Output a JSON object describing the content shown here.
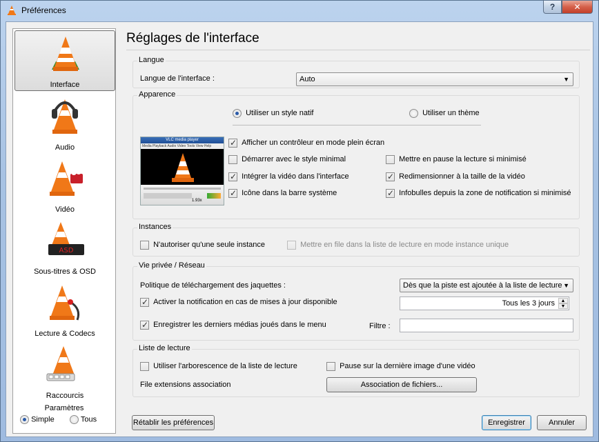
{
  "window": {
    "title": "Préférences",
    "help_label": "?",
    "close_label": "✕"
  },
  "sidebar": {
    "items": [
      {
        "label": "Interface",
        "selected": true
      },
      {
        "label": "Audio"
      },
      {
        "label": "Vidéo"
      },
      {
        "label": "Sous-titres & OSD"
      },
      {
        "label": "Lecture & Codecs"
      },
      {
        "label": "Raccourcis"
      }
    ],
    "params": {
      "title": "Paramètres",
      "simple": "Simple",
      "all": "Tous",
      "selected": "Simple"
    }
  },
  "page": {
    "title": "Réglages de l'interface"
  },
  "langue": {
    "title": "Langue",
    "label": "Langue de l'interface :",
    "value": "Auto"
  },
  "apparence": {
    "title": "Apparence",
    "native_style": "Utiliser un style natif",
    "theme": "Utiliser un thème",
    "preview": {
      "title": "VLC media player",
      "menu": [
        "Media",
        "Playback",
        "Audio",
        "Video",
        "Tools",
        "View",
        "Help"
      ],
      "time": "1.93x"
    },
    "options": {
      "fullscreen_controller": {
        "label": "Afficher un contrôleur en mode plein écran",
        "checked": true
      },
      "minimal": {
        "label": "Démarrer avec le style minimal",
        "checked": false
      },
      "pause_minimized": {
        "label": "Mettre en pause la lecture si minimisé",
        "checked": false
      },
      "embed_video": {
        "label": "Intégrer la vidéo dans l'interface",
        "checked": true
      },
      "resize": {
        "label": "Redimensionner à la taille de la vidéo",
        "checked": true
      },
      "systray": {
        "label": "Icône dans la barre système",
        "checked": true
      },
      "tooltips": {
        "label": "Infobulles depuis la zone de notification si minimisé",
        "checked": true
      }
    }
  },
  "instances": {
    "title": "Instances",
    "single": {
      "label": "N'autoriser qu'une seule instance",
      "checked": false
    },
    "enqueue": {
      "label": "Mettre en file dans la liste de lecture en mode instance unique",
      "checked": false,
      "disabled": true
    }
  },
  "privacy": {
    "title": "Vie privée / Réseau",
    "art_label": "Politique de téléchargement des jaquettes :",
    "art_value": "Dès que la piste est ajoutée à la liste de lecture",
    "update": {
      "label": "Activer la notification en cas de mises à jour disponible",
      "checked": true
    },
    "update_interval": "Tous les 3 jours",
    "recent": {
      "label": "Enregistrer les derniers médias joués dans le menu",
      "checked": true
    },
    "filter_label": "Filtre :",
    "filter_value": ""
  },
  "playlist": {
    "title": "Liste de lecture",
    "tree": {
      "label": "Utiliser l'arborescence de la liste de lecture",
      "checked": false
    },
    "pause_last": {
      "label": "Pause sur la dernière image d'une vidéo",
      "checked": false
    },
    "assoc_label": "File extensions association",
    "assoc_button": "Association de fichiers..."
  },
  "footer": {
    "reset": "Rétablir les préférences",
    "save": "Enregistrer",
    "cancel": "Annuler"
  },
  "colors": {
    "cone_orange": "#f07818",
    "accent": "#2a5aa8"
  }
}
